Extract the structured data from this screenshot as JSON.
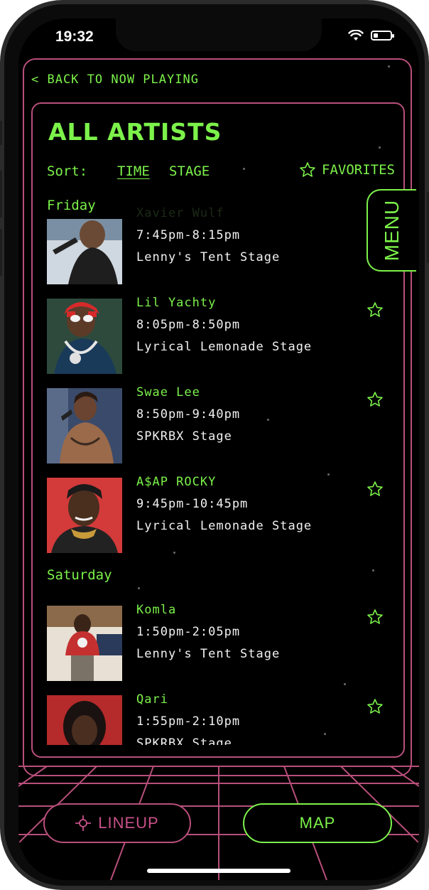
{
  "status_bar": {
    "time": "19:32"
  },
  "nav": {
    "back_label": "< BACK TO NOW PLAYING"
  },
  "page": {
    "title": "ALL ARTISTS"
  },
  "sort": {
    "label": "Sort:",
    "time_label": "TIME",
    "stage_label": "STAGE",
    "favorites_label": "FAVORITES",
    "active": "TIME"
  },
  "menu_tab": {
    "label": "MENU"
  },
  "days": [
    {
      "label": "Friday",
      "artists": [
        {
          "name": "Xavier Wulf",
          "time": "7:45pm-8:15pm",
          "stage": "Lenny's Tent Stage"
        },
        {
          "name": "Lil Yachty",
          "time": "8:05pm-8:50pm",
          "stage": "Lyrical Lemonade Stage"
        },
        {
          "name": "Swae Lee",
          "time": "8:50pm-9:40pm",
          "stage": "SPKRBX Stage"
        },
        {
          "name": "A$AP ROCKY",
          "time": "9:45pm-10:45pm",
          "stage": "Lyrical Lemonade Stage"
        }
      ]
    },
    {
      "label": "Saturday",
      "artists": [
        {
          "name": "Komla",
          "time": "1:50pm-2:05pm",
          "stage": "Lenny's Tent Stage"
        },
        {
          "name": "Qari",
          "time": "1:55pm-2:10pm",
          "stage": "SPKRBX Stage"
        }
      ]
    }
  ],
  "bottom_nav": {
    "lineup_label": "LINEUP",
    "map_label": "MAP"
  },
  "colors": {
    "accent": "#7cf24a",
    "frame": "#b84f7b",
    "background": "#000000"
  }
}
